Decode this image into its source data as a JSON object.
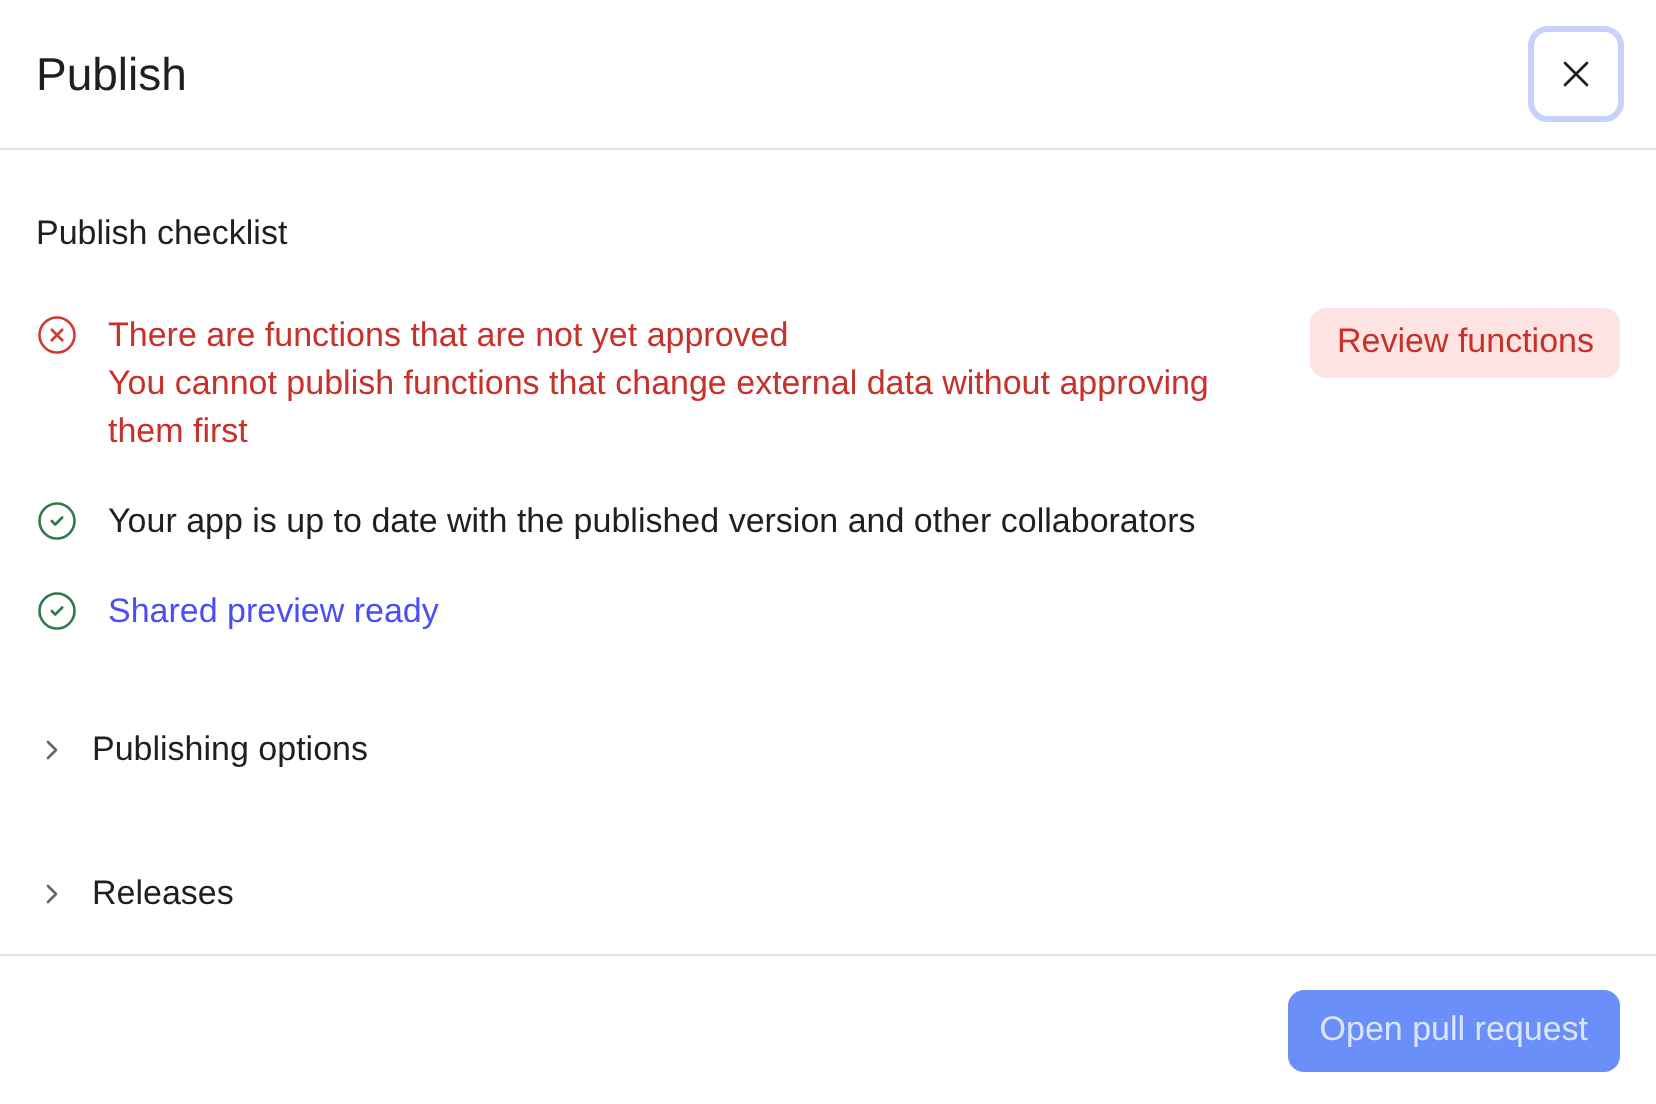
{
  "dialog": {
    "title": "Publish"
  },
  "checklist": {
    "heading": "Publish checklist",
    "items": [
      {
        "kind": "error",
        "title": "There are functions that are not yet approved",
        "detail": "You cannot publish functions that change external data without approving them first",
        "action": "Review functions"
      },
      {
        "kind": "ok",
        "text": "Your app is up to date with the published version and other collaborators"
      },
      {
        "kind": "link",
        "text": "Shared preview ready"
      }
    ]
  },
  "sections": [
    {
      "label": "Publishing options",
      "expanded": false
    },
    {
      "label": "Releases",
      "expanded": false
    }
  ],
  "footer": {
    "button": {
      "label": "Open pull request",
      "disabled": true
    }
  }
}
